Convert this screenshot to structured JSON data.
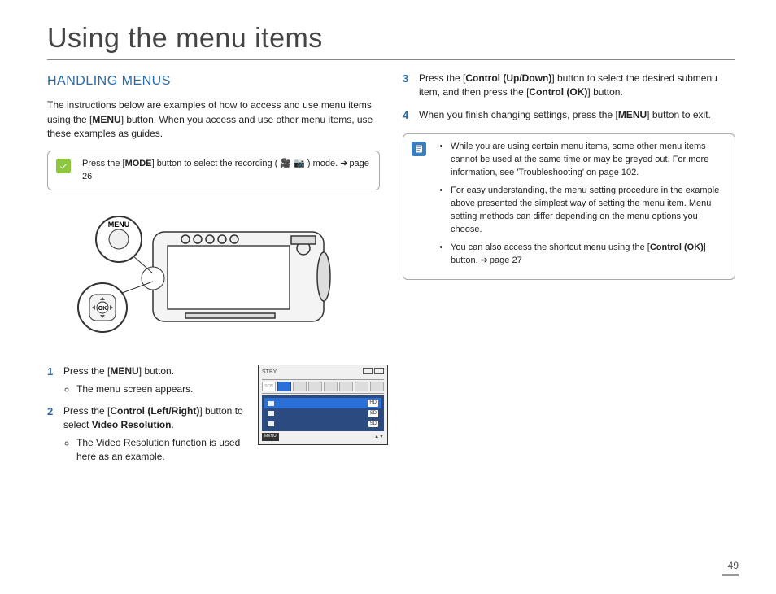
{
  "title": "Using the menu items",
  "section_heading": "HANDLING MENUS",
  "intro_html": "The instructions below are examples of how to access and use menu items using the [<b>MENU</b>] button. When you access and use other menu items, use these examples as guides.",
  "tip1_html": "Press the [<b>MODE</b>] button to select the recording ( <span data-name='video-icon'>🎥</span> <span data-name='camera-icon'>📷</span> ) mode. <span class='arrow'></span>page 26",
  "camcorder_label_menu": "MENU",
  "camcorder_label_ok": "OK",
  "steps": {
    "s1_html": "Press the [<b>MENU</b>] button.",
    "s1_sub": "The menu screen appears.",
    "s2_html": "Press the [<b>Control (Left/Right)</b>] button to select <b>Video Resolution</b>.",
    "s2_sub": "The Video Resolution function is used here as an example.",
    "s3_html": "Press the [<b>Control (Up/Down)</b>] button to select the desired submenu item, and then press the [<b>Control (OK)</b>] button.",
    "s4_html": "When you finish changing settings, press the [<b>MENU</b>] button to exit."
  },
  "tip2": {
    "b1": "While you are using certain menu items, some other menu items cannot be used at the same time or may be greyed out. For more information, see 'Troubleshooting' on page 102.",
    "b2": "For easy understanding, the menu setting procedure in the example above presented the simplest way of setting the menu item. Menu setting methods can differ depending on the menu options you choose.",
    "b3_html": "You can also access the shortcut menu using the [<b>Control (OK)</b>] button. <span class='arrow'></span>page 27"
  },
  "menu_screen": {
    "top_left": "STBY",
    "tab_scn": "SCN",
    "rows": [
      "HD",
      "SD",
      "SD"
    ],
    "footer_menu": "MENU"
  },
  "page_number": "49"
}
